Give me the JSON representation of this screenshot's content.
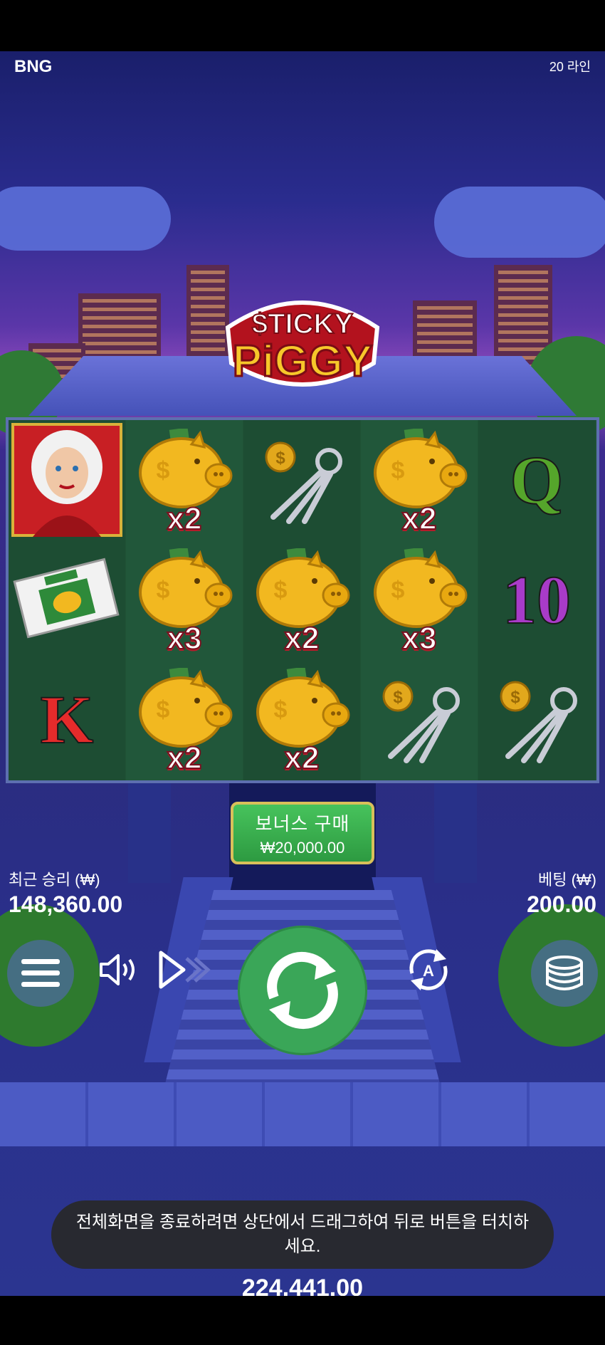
{
  "header": {
    "brand": "BNG",
    "lines": "20 라인"
  },
  "game": {
    "title_line1": "$TICKY",
    "title_line2": "PiGGY"
  },
  "reels": [
    [
      {
        "symbol": "lady"
      },
      {
        "symbol": "news"
      },
      {
        "symbol": "K"
      }
    ],
    [
      {
        "symbol": "piggy",
        "multiplier": "x2"
      },
      {
        "symbol": "piggy",
        "multiplier": "x3"
      },
      {
        "symbol": "piggy",
        "multiplier": "x2"
      }
    ],
    [
      {
        "symbol": "keys"
      },
      {
        "symbol": "piggy",
        "multiplier": "x2"
      },
      {
        "symbol": "piggy",
        "multiplier": "x2"
      }
    ],
    [
      {
        "symbol": "piggy",
        "multiplier": "x2"
      },
      {
        "symbol": "piggy",
        "multiplier": "x3"
      },
      {
        "symbol": "keys"
      }
    ],
    [
      {
        "symbol": "Q"
      },
      {
        "symbol": "10"
      },
      {
        "symbol": "keys"
      }
    ]
  ],
  "bonus": {
    "label": "보너스 구매",
    "price": "₩20,000.00"
  },
  "last_win": {
    "label": "최근 승리 (₩)",
    "value": "148,360.00"
  },
  "bet": {
    "label": "베팅 (₩)",
    "value": "200.00"
  },
  "balance": {
    "value": "224,441.00"
  },
  "toast": {
    "text": "전체화면을 종료하려면 상단에서 드래그하여 뒤로 버튼을 터치하세요."
  },
  "colors": {
    "spin": "#3aa658",
    "bonus": "#3fb556",
    "felt": "#1f5235",
    "sky": "#2a2c8e"
  },
  "icons": {
    "menu": "menu-icon",
    "sound": "speaker-icon",
    "turbo": "fast-forward-icon",
    "spin": "spin-arrows-icon",
    "auto": "autoplay-icon",
    "bet": "coin-stack-icon"
  }
}
